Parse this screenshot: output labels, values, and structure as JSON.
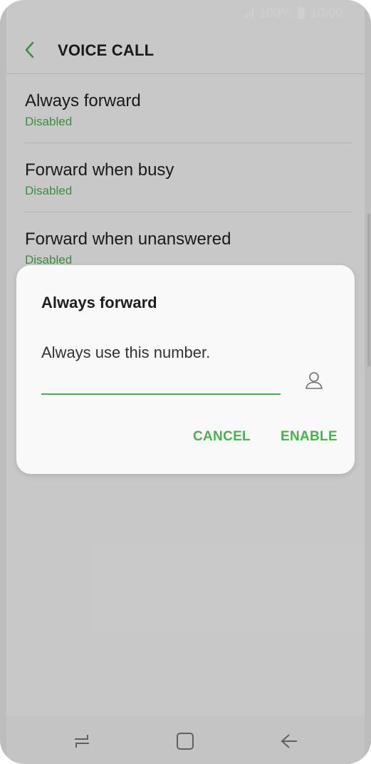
{
  "status_bar": {
    "battery": "100%",
    "time": "10:00"
  },
  "header": {
    "title": "VOICE CALL",
    "back_icon": "chevron-left-icon"
  },
  "list": {
    "items": [
      {
        "title": "Always forward",
        "status": "Disabled"
      },
      {
        "title": "Forward when busy",
        "status": "Disabled"
      },
      {
        "title": "Forward when unanswered",
        "status": "Disabled"
      }
    ]
  },
  "dialog": {
    "title": "Always forward",
    "message": "Always use this number.",
    "input_value": "",
    "contacts_icon": "person-icon",
    "cancel_label": "CANCEL",
    "enable_label": "ENABLE"
  },
  "nav_bar": {
    "recents_icon": "recents-icon",
    "home_icon": "home-icon",
    "back_icon": "back-arrow-icon"
  },
  "colors": {
    "accent": "#4caf50",
    "scrim": "rgba(0,0,0,0.19)",
    "dialog_bg": "#f9f9f9"
  }
}
